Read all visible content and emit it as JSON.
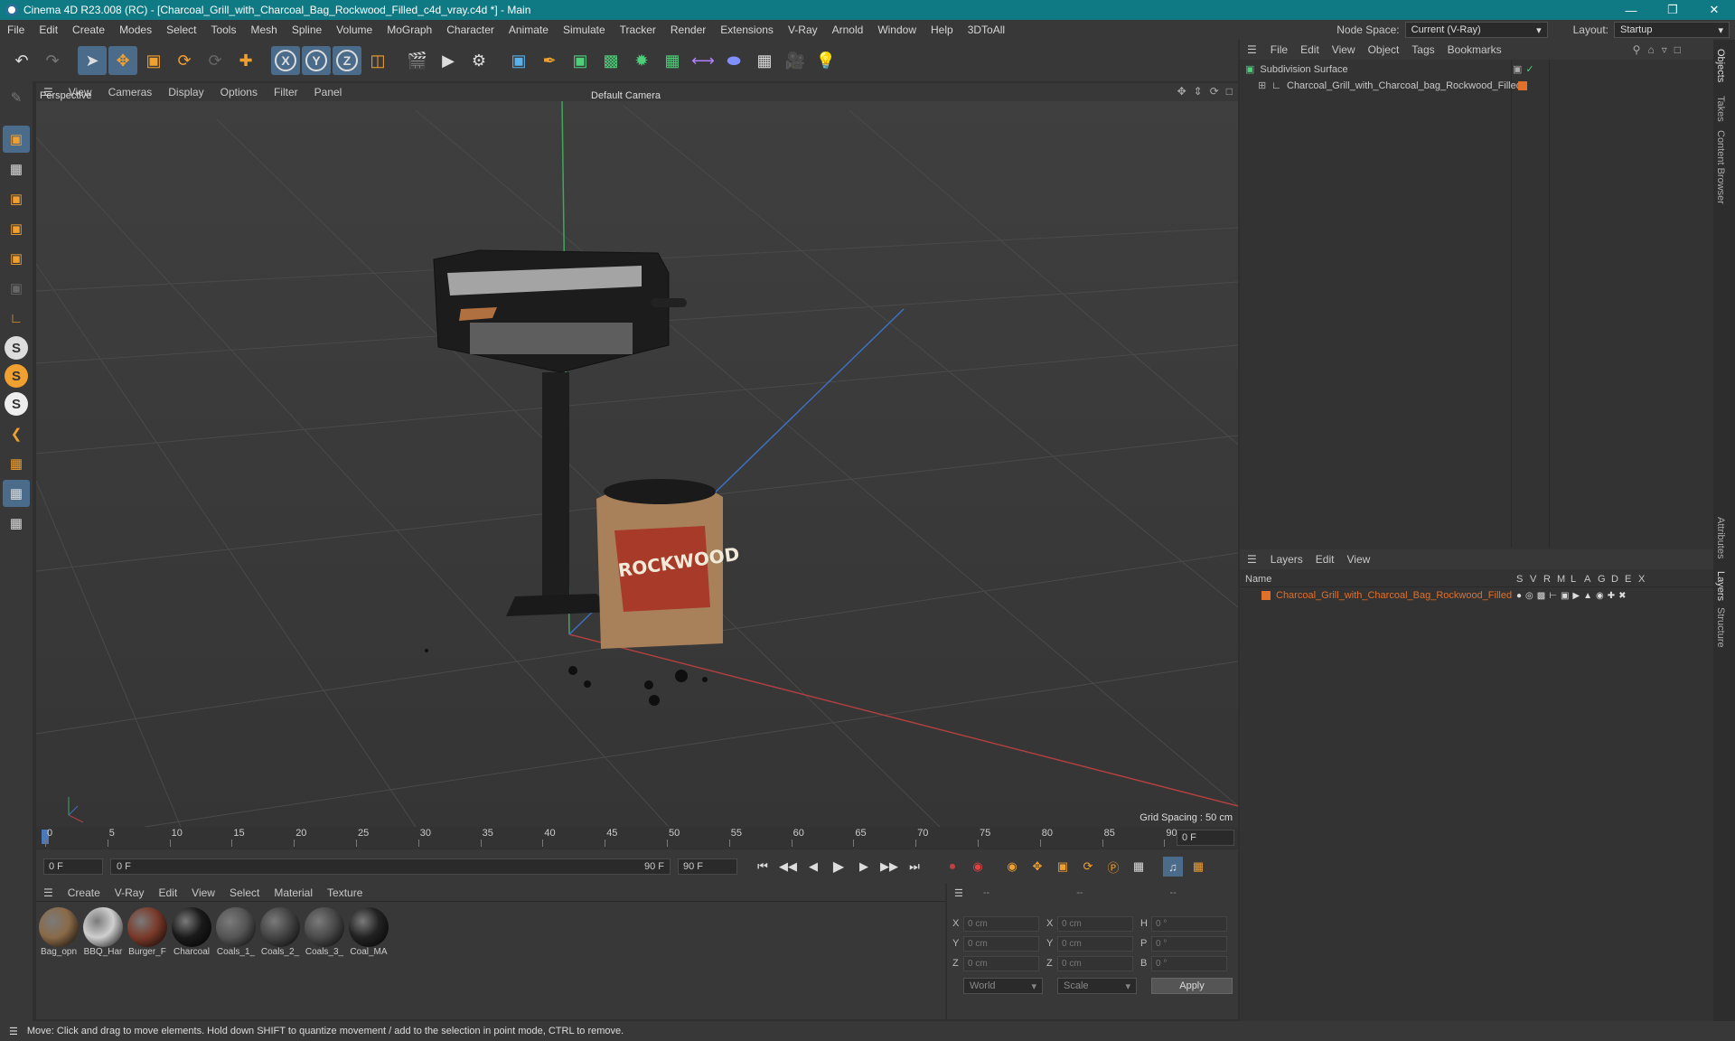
{
  "titlebar": {
    "title": "Cinema 4D R23.008 (RC) - [Charcoal_Grill_with_Charcoal_Bag_Rockwood_Filled_c4d_vray.c4d *] - Main"
  },
  "menubar": {
    "items": [
      "File",
      "Edit",
      "Create",
      "Modes",
      "Select",
      "Tools",
      "Mesh",
      "Spline",
      "Volume",
      "MoGraph",
      "Character",
      "Animate",
      "Simulate",
      "Tracker",
      "Render",
      "Extensions",
      "V-Ray",
      "Arnold",
      "Window",
      "Help",
      "3DToAll"
    ],
    "node_space_label": "Node Space:",
    "node_space_value": "Current (V-Ray)",
    "layout_label": "Layout:",
    "layout_value": "Startup"
  },
  "viewport": {
    "menu": [
      "View",
      "Cameras",
      "Display",
      "Options",
      "Filter",
      "Panel"
    ],
    "view_name": "Perspective",
    "camera": "Default Camera",
    "grid_spacing": "Grid Spacing : 50 cm",
    "bag_label": "ROCKWOOD"
  },
  "timeline": {
    "ticks": [
      "0",
      "5",
      "10",
      "15",
      "20",
      "25",
      "30",
      "35",
      "40",
      "45",
      "50",
      "55",
      "60",
      "65",
      "70",
      "75",
      "80",
      "85",
      "90"
    ],
    "current_frame": "0 F"
  },
  "playbar": {
    "start": "0 F",
    "range_start": "0 F",
    "range_end": "90 F",
    "end": "90 F"
  },
  "materials": {
    "menu": [
      "Create",
      "V-Ray",
      "Edit",
      "View",
      "Select",
      "Material",
      "Texture"
    ],
    "items": [
      {
        "name": "Bag_opn",
        "color": "#8a6a48"
      },
      {
        "name": "BBQ_Har",
        "color": "#cfcfcf"
      },
      {
        "name": "Burger_F",
        "color": "#7a3a2a"
      },
      {
        "name": "Charcoal",
        "color": "#1a1a1a"
      },
      {
        "name": "Coals_1_",
        "color": "#555555"
      },
      {
        "name": "Coals_2_",
        "color": "#444444"
      },
      {
        "name": "Coals_3_",
        "color": "#4a4a4a"
      },
      {
        "name": "Coal_MA",
        "color": "#222222"
      }
    ]
  },
  "coords": {
    "headers": [
      "--",
      "--",
      "--"
    ],
    "rows": [
      {
        "a": "X",
        "av": "0 cm",
        "b": "X",
        "bv": "0 cm",
        "c": "H",
        "cv": "0 °"
      },
      {
        "a": "Y",
        "av": "0 cm",
        "b": "Y",
        "bv": "0 cm",
        "c": "P",
        "cv": "0 °"
      },
      {
        "a": "Z",
        "av": "0 cm",
        "b": "Z",
        "bv": "0 cm",
        "c": "B",
        "cv": "0 °"
      }
    ],
    "world": "World",
    "scale": "Scale",
    "apply": "Apply"
  },
  "objects": {
    "menu": [
      "File",
      "Edit",
      "View",
      "Object",
      "Tags",
      "Bookmarks"
    ],
    "tree": [
      {
        "name": "Subdivision Surface"
      },
      {
        "name": "Charcoal_Grill_with_Charcoal_bag_Rockwood_Filled"
      }
    ]
  },
  "layers": {
    "menu": [
      "Layers",
      "Edit",
      "View"
    ],
    "header_name": "Name",
    "flags": [
      "S",
      "V",
      "R",
      "M",
      "L",
      "A",
      "G",
      "D",
      "E",
      "X"
    ],
    "rows": [
      {
        "name": "Charcoal_Grill_with_Charcoal_Bag_Rockwood_Filled",
        "color": "#e0702a"
      }
    ]
  },
  "side_tabs": [
    "Objects",
    "Takes",
    "Content Browser",
    "Attributes",
    "Layers",
    "Structure"
  ],
  "status": {
    "text": "Move: Click and drag to move elements. Hold down SHIFT to quantize movement / add to the selection in point mode, CTRL to remove."
  }
}
